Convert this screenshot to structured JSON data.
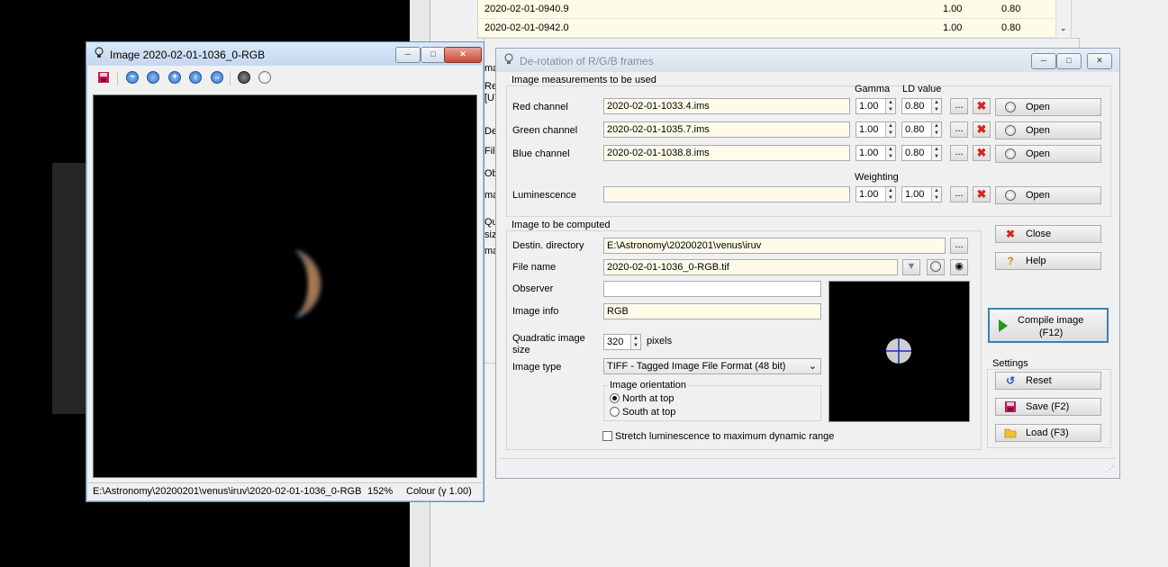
{
  "background": {
    "list_rows": [
      {
        "name": "2020-02-01-0940.9",
        "gamma": "1.00",
        "ld": "0.80"
      },
      {
        "name": "2020-02-01-0942.0",
        "gamma": "1.00",
        "ld": "0.80"
      }
    ],
    "side_labels": [
      "ma",
      "Re",
      "[UT",
      "De",
      "File",
      "Obj",
      "ma",
      "Qua",
      "size",
      "ma"
    ]
  },
  "image_window": {
    "title": "Image  2020-02-01-1036_0-RGB",
    "status_path": "E:\\Astronomy\\20200201\\venus\\iruv\\2020-02-01-1036_0-RGB",
    "status_zoom": "152%",
    "status_colour": "Colour (γ 1.00)"
  },
  "derot": {
    "title": "De-rotation of R/G/B frames",
    "group_measurements": "Image measurements to be used",
    "col_gamma": "Gamma",
    "col_ld": "LD value",
    "col_weighting": "Weighting",
    "channels": [
      {
        "label": "Red channel",
        "file": "2020-02-01-1033.4.ims",
        "gamma": "1.00",
        "ld": "0.80"
      },
      {
        "label": "Green channel",
        "file": "2020-02-01-1035.7.ims",
        "gamma": "1.00",
        "ld": "0.80"
      },
      {
        "label": "Blue channel",
        "file": "2020-02-01-1038.8.ims",
        "gamma": "1.00",
        "ld": "0.80"
      }
    ],
    "luminescence": {
      "label": "Luminescence",
      "file": "",
      "v1": "1.00",
      "v2": "1.00"
    },
    "browse_label": "...",
    "open_label": "Open",
    "group_computed": "Image to be computed",
    "dest_label": "Destin. directory",
    "dest_value": "E:\\Astronomy\\20200201\\venus\\iruv",
    "filename_label": "File name",
    "filename_value": "2020-02-01-1036_0-RGB.tif",
    "observer_label": "Observer",
    "observer_value": "",
    "info_label": "Image info",
    "info_value": "RGB",
    "size_label_1": "Quadratic image",
    "size_label_2": "size",
    "size_value": "320",
    "size_unit": "pixels",
    "type_label": "Image type",
    "type_value": "TIFF - Tagged Image File Format (48 bit)",
    "orientation_group": "Image orientation",
    "north_label": "North at top",
    "south_label": "South at top",
    "orientation_selected": "North at top",
    "stretch_label": "Stretch luminescence to maximum dynamic range",
    "close_label": "Close",
    "help_label": "Help",
    "compile_label_1": "Compile image",
    "compile_label_2": "(F12)",
    "settings_group": "Settings",
    "reset_label": "Reset",
    "save_label": "Save (F2)",
    "load_label": "Load (F3)"
  },
  "colors": {
    "accent": "#2f6fbf",
    "title_bg": "#c5d8ef",
    "input_bg": "#fefbe9",
    "close_red": "#c74a35"
  }
}
